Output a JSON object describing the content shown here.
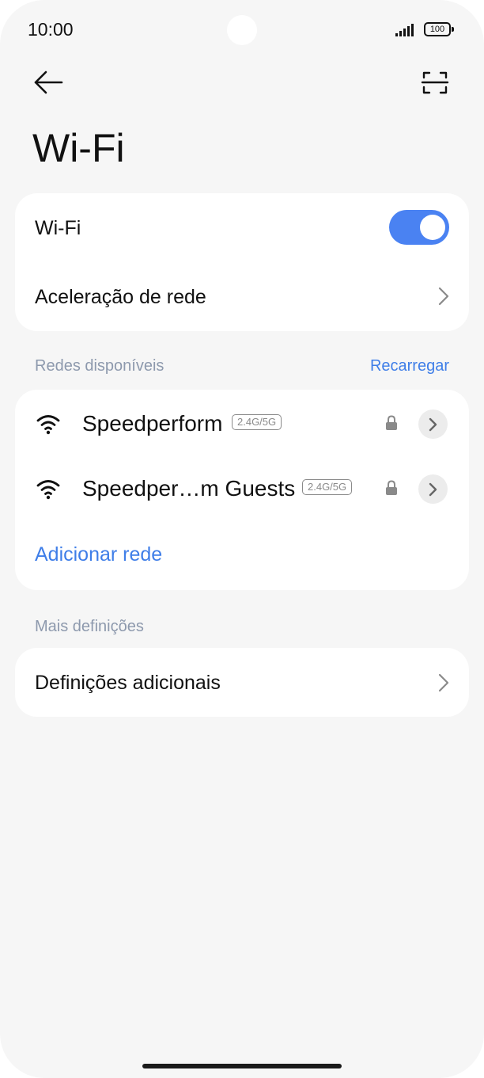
{
  "status_bar": {
    "time": "10:00",
    "battery": "100",
    "icons": [
      "signal-icon",
      "battery-icon"
    ]
  },
  "header": {
    "back_icon": "arrow-left-icon",
    "scan_icon": "scan-qr-icon",
    "title": "Wi-Fi"
  },
  "main_card": {
    "wifi_label": "Wi-Fi",
    "wifi_enabled": true,
    "acceleration_label": "Aceleração de rede"
  },
  "available_networks": {
    "section_label": "Redes disponíveis",
    "reload_label": "Recarregar",
    "networks": [
      {
        "name": "Speedperform",
        "band": "2.4G/5G",
        "secured": true
      },
      {
        "name": "Speedper…m Guests",
        "band": "2.4G/5G",
        "secured": true
      }
    ],
    "add_network_label": "Adicionar rede"
  },
  "more_settings": {
    "section_label": "Mais definições",
    "additional_label": "Definições adicionais"
  },
  "colors": {
    "accent": "#3f7ee8",
    "toggle_on": "#4a82f2",
    "background": "#f6f6f6",
    "section_label": "#8d99ad"
  }
}
